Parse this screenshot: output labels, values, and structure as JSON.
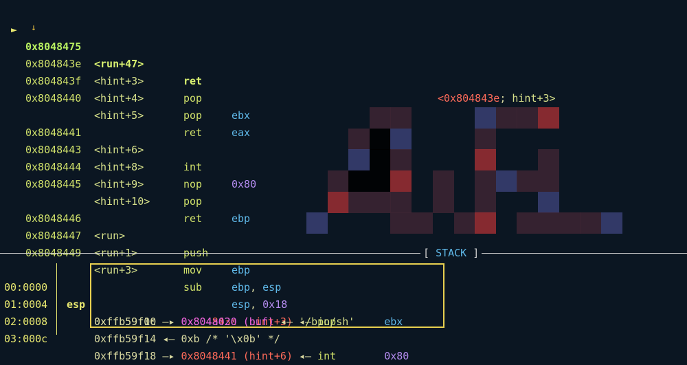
{
  "disasm": {
    "current": {
      "arrow": "►",
      "addr": "0x8048475",
      "sym": "<run+47>",
      "mn": "ret",
      "target_addr": "<0x804843e",
      "target_sep": "; ",
      "target_sym": "hint+3>"
    },
    "down_arrow": "↓",
    "rows": [
      {
        "addr": "0x804843e",
        "sym": "<hint+3>",
        "mn": "pop",
        "op1": "ebx"
      },
      {
        "addr": "0x804843f",
        "sym": "<hint+4>",
        "mn": "pop",
        "op1": "eax"
      },
      {
        "addr": "0x8048440",
        "sym": "<hint+5>",
        "mn": "ret",
        "op1": ""
      },
      {
        "addr": "0x8048441",
        "sym": "<hint+6>",
        "mn": "int",
        "op1": "",
        "num": "0x80"
      },
      {
        "addr": "0x8048443",
        "sym": "<hint+8>",
        "mn": "nop",
        "op1": ""
      },
      {
        "addr": "0x8048444",
        "sym": "<hint+9>",
        "mn": "pop",
        "op1": "ebp"
      },
      {
        "addr": "0x8048445",
        "sym": "<hint+10>",
        "mn": "ret",
        "op1": ""
      },
      {
        "addr": "0x8048446",
        "sym": "<run>",
        "mn": "push",
        "op1": "ebp"
      },
      {
        "addr": "0x8048447",
        "sym": "<run+1>",
        "mn": "mov",
        "op1": "ebp",
        "sep": ", ",
        "op2": "esp"
      },
      {
        "addr": "0x8048449",
        "sym": "<run+3>",
        "mn": "sub",
        "op1": "esp",
        "sep": ", ",
        "num": "0x18"
      }
    ]
  },
  "stack": {
    "title_open": "[ ",
    "title": "STACK",
    "title_close": " ]",
    "register": "esp",
    "rows": [
      {
        "idx": "00:0000",
        "addr": "0xffb59f0c",
        "arrow": " —▸ ",
        "ptr": "0x804843e",
        "ptr_sym": " (hint+3)",
        "arrow2": " ◂— ",
        "mn": "pop",
        "op": "ebx"
      },
      {
        "idx": "01:0004",
        "addr": "0xffb59f10",
        "arrow": " —▸ ",
        "ptr": "0x804a020",
        "ptr_sym": " (buf)",
        "arrow2": " ◂— ",
        "str": "'/bin/sh'"
      },
      {
        "idx": "02:0008",
        "addr": "0xffb59f14",
        "arrow": " ◂— ",
        "plain": "0xb /* '\\x0b' */"
      },
      {
        "idx": "03:000c",
        "addr": "0xffb59f18",
        "arrow": " —▸ ",
        "ptr": "0x8048441",
        "ptr_sym": " (hint+6)",
        "arrow2": " ◂— ",
        "mn": "int",
        "num": "0x80"
      }
    ]
  },
  "colors": {
    "background": "#0b1622",
    "highlight": "#e8d050",
    "pointer": "#ff6b5a",
    "register": "#5fb8e8"
  }
}
